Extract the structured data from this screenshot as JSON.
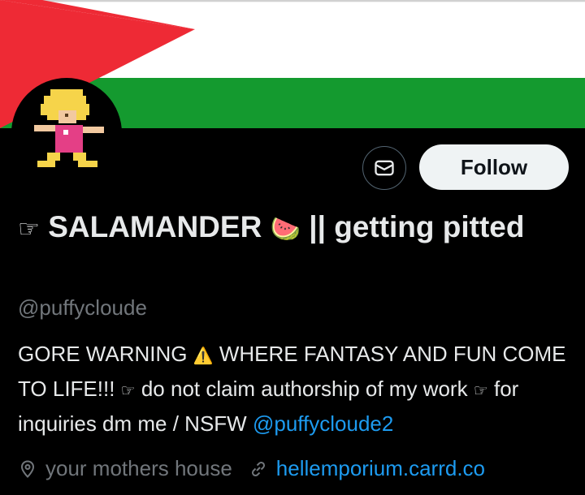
{
  "banner": {
    "colors": {
      "red": "#ee2a35",
      "white": "#ffffff",
      "green": "#149a2f",
      "black": "#000000"
    }
  },
  "actions": {
    "message_icon": "envelope-icon",
    "follow_label": "Follow"
  },
  "profile": {
    "name_prefix_icon": "☞",
    "name_part1": "SALAMANDER",
    "name_emoji": "🍉",
    "name_part2": "|| getting pitted",
    "handle": "@puffycloude"
  },
  "bio": {
    "part1": "GORE WARNING",
    "warning_icon": "⚠️",
    "part2": "WHERE FANTASY AND FUN COME TO LIFE!!!",
    "pointer1": "☞",
    "part3": "do not claim authorship of my work",
    "pointer2": "☞",
    "part4": "for inquiries dm me / NSFW",
    "mention": "@puffycloude2"
  },
  "meta": {
    "location_icon": "location-pin-icon",
    "location": "your mothers house",
    "link_icon": "link-icon",
    "link": "hellemporium.carrd.co"
  },
  "colors": {
    "link": "#1d9bf0",
    "muted": "#71767b",
    "text": "#e7e9ea"
  }
}
